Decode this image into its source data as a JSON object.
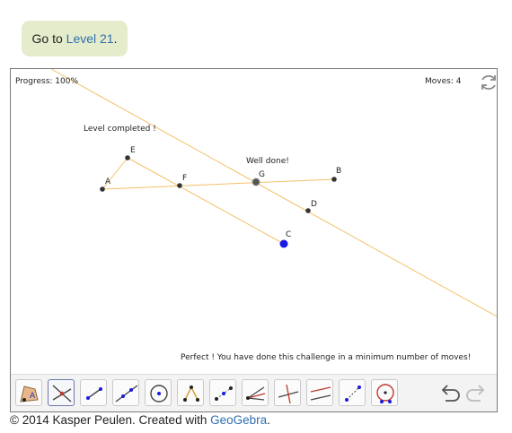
{
  "goto": {
    "prefix": "Go to ",
    "link": "Level 21",
    "suffix": "."
  },
  "status": {
    "progress": "Progress: 100%",
    "moves": "Moves: 4"
  },
  "messages": {
    "level_completed": "Level completed !",
    "well_done": "Well done!",
    "perfect": "Perfect ! You have done this challenge in a minimum number of moves!"
  },
  "points": {
    "A": "A",
    "B": "B",
    "C": "C",
    "D": "D",
    "E": "E",
    "F": "F",
    "G": "G"
  },
  "footer": {
    "text": "© 2014 Kasper Peulen. Created with ",
    "link": "GeoGebra",
    "suffix": "."
  },
  "tools": [
    "move-tool",
    "intersect-tool",
    "segment-tool",
    "line-tool",
    "circle-tool",
    "angle-tool",
    "midpoint-tool",
    "angle-bisector-tool",
    "perpendicular-tool",
    "parallel-tool",
    "perpendicular-bisector-tool",
    "compass-tool"
  ],
  "colors": {
    "construction": "#f5c06a",
    "point": "#333333",
    "free_point": "#1a1ae6",
    "callout": "#e4eccb",
    "link": "#2f6fae"
  }
}
